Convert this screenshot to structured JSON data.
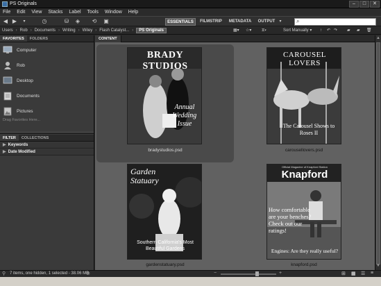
{
  "window": {
    "title": "PS Originals"
  },
  "menu": [
    "File",
    "Edit",
    "View",
    "Stacks",
    "Label",
    "Tools",
    "Window",
    "Help"
  ],
  "workspaces": {
    "tabs": [
      "ESSENTIALS",
      "FILMSTRIP",
      "METADATA",
      "OUTPUT"
    ],
    "active": "ESSENTIALS"
  },
  "search": {
    "placeholder": "",
    "value": ""
  },
  "breadcrumbs": [
    "Users",
    "Rob",
    "Documents",
    "Writing",
    "Wiley",
    "Flash Catalyst...",
    "PS Originals"
  ],
  "sort": {
    "label": "Sort Manually"
  },
  "left_panel": {
    "tabs": [
      "FAVORITES",
      "FOLDERS"
    ],
    "favorites": [
      {
        "label": "Computer",
        "icon": "computer-icon"
      },
      {
        "label": "Rob",
        "icon": "user-icon"
      },
      {
        "label": "Desktop",
        "icon": "desktop-icon"
      },
      {
        "label": "Documents",
        "icon": "documents-icon"
      },
      {
        "label": "Pictures",
        "icon": "pictures-icon"
      }
    ],
    "drag_hint": "Drag Favorites Here...",
    "filter_tabs": [
      "FILTER",
      "COLLECTIONS"
    ],
    "filters": [
      "Keywords",
      "Date Modified"
    ]
  },
  "content": {
    "tab": "CONTENT",
    "thumbnails": [
      {
        "filename": "bradystudios.psd",
        "cover_title": "BRADY STUDIOS",
        "cover_text": "Annual Wedding Issue",
        "selected": true
      },
      {
        "filename": "carousellovers.psd",
        "cover_title": "CAROUSEL LOVERS",
        "cover_text": "The Carousel Shows to Roses II",
        "selected": false
      },
      {
        "filename": "gardenstatuary.psd",
        "cover_title": "Garden Statuary",
        "cover_text": "Southern California's Most Beautiful Gardens",
        "selected": false
      },
      {
        "filename": "knapford.psd",
        "cover_title": "Knapford",
        "cover_kicker": "Official Magazine of Knapford Station",
        "cover_text": "How comfortable are your benches? Check out our ratings!",
        "cover_footer": "Engines: Are they really useful?",
        "selected": false
      }
    ]
  },
  "status": {
    "text": "7 items, one hidden, 1 selected - 38.06 MB"
  }
}
